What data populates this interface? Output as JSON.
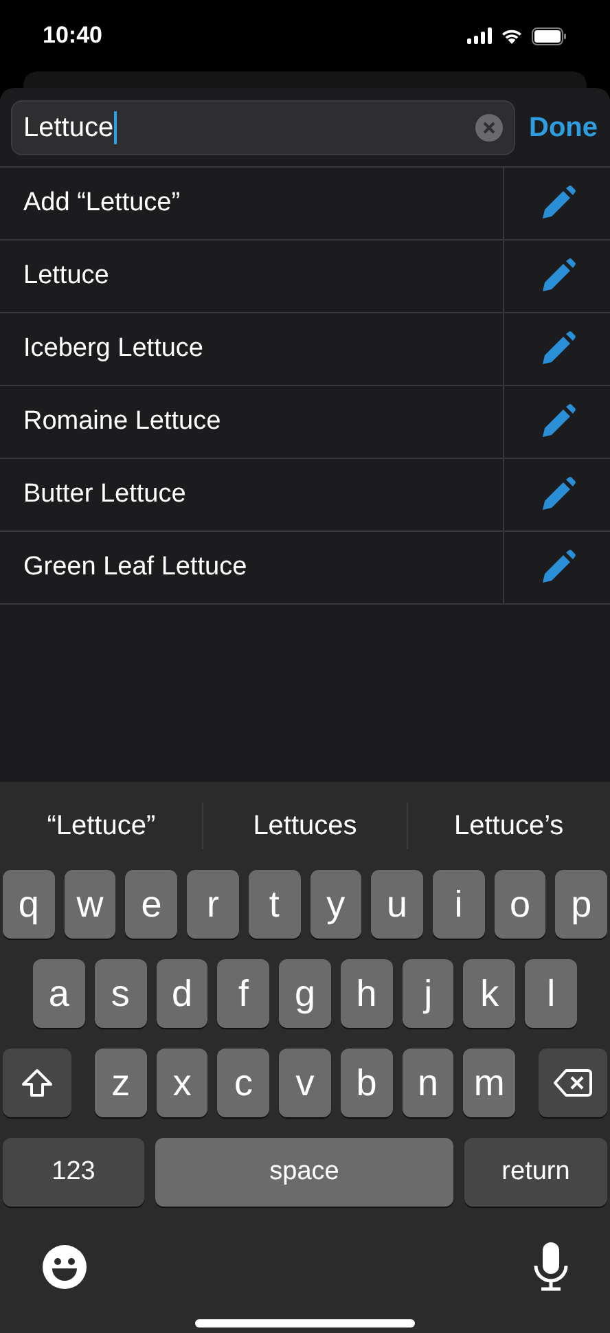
{
  "status_bar": {
    "time": "10:40"
  },
  "search": {
    "value": "Lettuce",
    "done": "Done"
  },
  "items": [
    {
      "label": "Add “Lettuce”"
    },
    {
      "label": "Lettuce"
    },
    {
      "label": "Iceberg Lettuce"
    },
    {
      "label": "Romaine Lettuce"
    },
    {
      "label": "Butter Lettuce"
    },
    {
      "label": "Green Leaf Lettuce"
    }
  ],
  "keyboard": {
    "suggestions": [
      "“Lettuce”",
      "Lettuces",
      "Lettuce’s"
    ],
    "rows": [
      [
        "q",
        "w",
        "e",
        "r",
        "t",
        "y",
        "u",
        "i",
        "o",
        "p"
      ],
      [
        "a",
        "s",
        "d",
        "f",
        "g",
        "h",
        "j",
        "k",
        "l"
      ],
      [
        "z",
        "x",
        "c",
        "v",
        "b",
        "n",
        "m"
      ]
    ],
    "numbers": "123",
    "space": "space",
    "return": "return"
  }
}
